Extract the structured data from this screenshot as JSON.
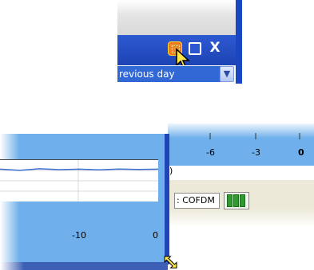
{
  "window": {
    "title_bar_buttons": {
      "minimize_icon": "minimize-icon",
      "maximize_icon": "maximize-icon",
      "close_label": "X"
    },
    "combo": {
      "selected_value": "revious day"
    }
  },
  "right_chart": {
    "x_tick_labels": [
      "-6",
      "-3",
      "0"
    ],
    "partial_label": ")"
  },
  "left_chart": {
    "x_tick_labels": [
      "-10",
      "0"
    ]
  },
  "status_bar": {
    "modulation": ": COFDM",
    "signal_icon": "signal-strength-icon"
  },
  "colors": {
    "title_bar": "#1e43b4",
    "panel_blue": "#6fb0ec",
    "selection": "#3168d5",
    "signal_green": "#2f9a2f",
    "minimize_highlight": "#e8892c"
  },
  "chart_data": {
    "type": "line",
    "series": [
      {
        "values": [
          0.6,
          0.55,
          0.62,
          0.58,
          0.6,
          0.57,
          0.61,
          0.59,
          0.6
        ]
      }
    ],
    "x_tick_labels": [
      "-10",
      "0"
    ]
  }
}
